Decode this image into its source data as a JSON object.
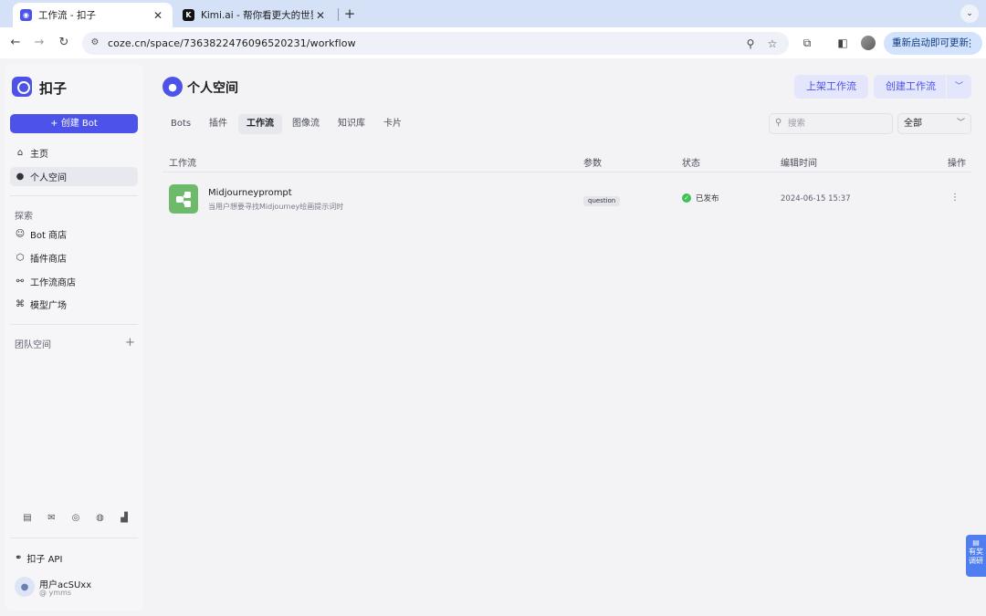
{
  "browser": {
    "tabs": [
      {
        "title": "工作流 - 扣子",
        "favicon_color": "#4d53e8"
      },
      {
        "title": "Kimi.ai - 帮你看更大的世界",
        "favicon_color": "#111111"
      }
    ],
    "url": "coze.cn/space/7363822476096520231/workflow",
    "update_label": "重新启动即可更新"
  },
  "sidebar": {
    "brand": "扣子",
    "create_bot": "+ 创建 Bot",
    "nav": [
      {
        "label": "主页",
        "icon": "home-icon"
      },
      {
        "label": "个人空间",
        "icon": "person-icon"
      }
    ],
    "explore_label": "探索",
    "explore": [
      {
        "label": "Bot 商店",
        "icon": "bot-icon"
      },
      {
        "label": "插件商店",
        "icon": "cube-icon"
      },
      {
        "label": "工作流商店",
        "icon": "workflow-icon"
      },
      {
        "label": "模型广场",
        "icon": "model-icon"
      }
    ],
    "team_label": "团队空间",
    "api_label": "扣子 API",
    "user": {
      "name": "用户acSUxx",
      "handle": "@ ymms"
    }
  },
  "header": {
    "title": "个人空间",
    "publish_button": "上架工作流",
    "create_button": "创建工作流"
  },
  "subtabs": [
    "Bots",
    "插件",
    "工作流",
    "图像流",
    "知识库",
    "卡片"
  ],
  "active_subtab": "工作流",
  "filter": {
    "search_placeholder": "搜索",
    "select_value": "全部"
  },
  "table": {
    "columns": [
      "工作流",
      "参数",
      "状态",
      "编辑时间",
      "操作"
    ],
    "rows": [
      {
        "name": "Midjourneyprompt",
        "description": "当用户想要寻找Midjourney绘画提示词时",
        "param": "question",
        "status": "已发布",
        "edit_time": "2024-06-15 15:37"
      }
    ]
  },
  "survey": {
    "line1": "有奖",
    "line2": "调研"
  },
  "colors": {
    "accent": "#4d53e8",
    "published": "#3ec254",
    "workflow_icon": "#6dbb6a"
  }
}
